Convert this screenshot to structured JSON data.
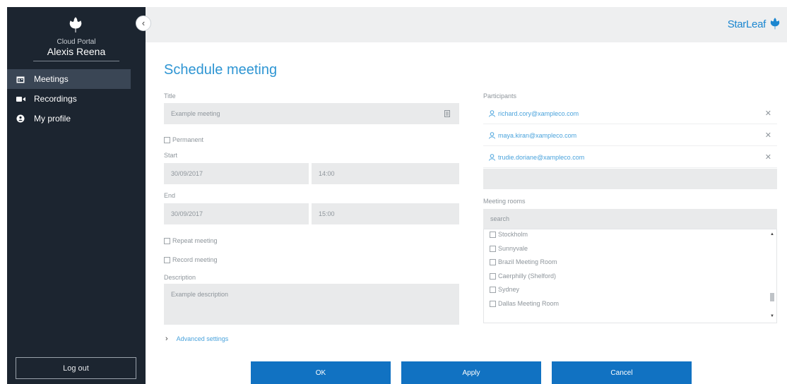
{
  "sidebar": {
    "portal_label": "Cloud Portal",
    "user_name": "Alexis Reena",
    "items": [
      {
        "label": "Meetings",
        "icon": "calendar-icon",
        "active": true
      },
      {
        "label": "Recordings",
        "icon": "video-camera-icon",
        "active": false
      },
      {
        "label": "My profile",
        "icon": "profile-icon",
        "active": false
      }
    ],
    "logout_label": "Log out",
    "collapse_glyph": "‹"
  },
  "header": {
    "brand": "StarLeaf"
  },
  "colors": {
    "sidebar_bg": "#1c2530",
    "accent": "#2e95d3",
    "button_blue": "#1172c2"
  },
  "page": {
    "title": "Schedule meeting"
  },
  "form": {
    "title_label": "Title",
    "title_value": "Example meeting",
    "permanent_label": "Permanent",
    "start_label": "Start",
    "start_date": "30/09/2017",
    "start_time": "14:00",
    "end_label": "End",
    "end_date": "30/09/2017",
    "end_time": "15:00",
    "repeat_label": "Repeat meeting",
    "record_label": "Record meeting",
    "description_label": "Description",
    "description_value": "Example description",
    "advanced_label": "Advanced settings"
  },
  "participants": {
    "label": "Participants",
    "items": [
      "richard.cory@xampleco.com",
      "maya.kiran@xampleco.com",
      "trudie.doriane@xampleco.com"
    ]
  },
  "rooms": {
    "label": "Meeting rooms",
    "search_placeholder": "search",
    "items": [
      "Stockholm",
      "Sunnyvale",
      "Brazil Meeting Room",
      "Caerphilly (Shelford)",
      "Sydney",
      "Dallas Meeting Room"
    ]
  },
  "buttons": {
    "ok": "OK",
    "apply": "Apply",
    "cancel": "Cancel"
  }
}
